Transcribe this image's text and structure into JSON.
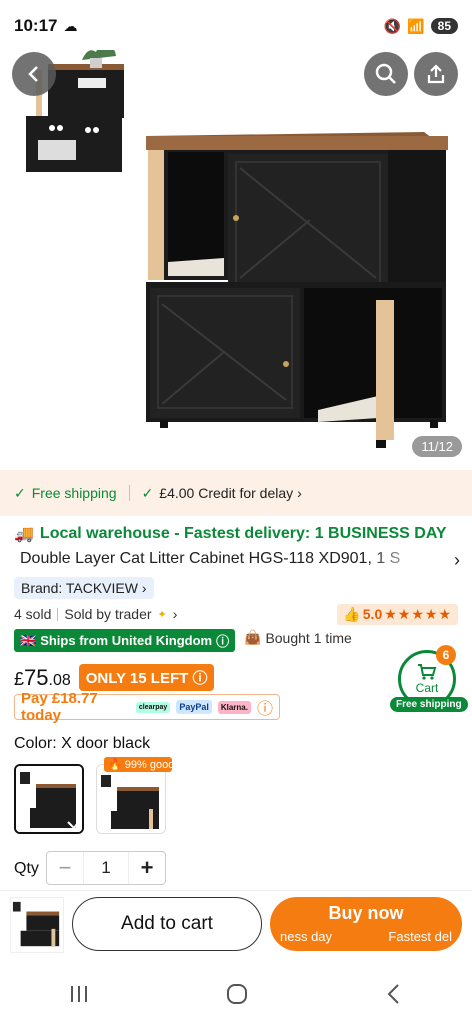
{
  "status": {
    "time": "10:17",
    "battery": "85"
  },
  "gallery": {
    "counter": "11/12"
  },
  "shipping": {
    "free": "Free shipping",
    "credit": "£4.00 Credit for delay"
  },
  "product": {
    "warehouse": "Local warehouse - Fastest delivery: 1 BUSINESS DAY",
    "title": "Double Layer Cat Litter Cabinet HGS-118 XD901, 1 S",
    "brand": "Brand: TACKVIEW",
    "sold": "4 sold",
    "seller": "Sold by trader",
    "rating": "5.0",
    "stars": "★★★★★",
    "ships_from": "Ships from United Kingdom",
    "bought": "Bought 1 time",
    "price_currency": "£",
    "price_int": "75",
    "price_dec": ".08",
    "stock": "ONLY 15 LEFT",
    "pay_today": "Pay £18.77 today",
    "pay_logos": [
      "clearpay",
      "PayPal",
      "Klarna."
    ],
    "color_label": "Color: X door black",
    "variant_badge": "99% good",
    "qty_label": "Qty",
    "qty_value": "1",
    "qty_minus": "−",
    "qty_plus": "+"
  },
  "cart": {
    "count": "6",
    "label": "Cart",
    "free_shipping": "Free shipping"
  },
  "actions": {
    "add_to_cart": "Add to cart",
    "buy_now": "Buy now",
    "buy_sub_left": "ness day",
    "buy_sub_right": "Fastest del"
  },
  "colors": {
    "accent_orange": "#f57c10",
    "green": "#0a8a38",
    "wood": "#8a5a35",
    "cabinet": "#1c1c1c"
  }
}
